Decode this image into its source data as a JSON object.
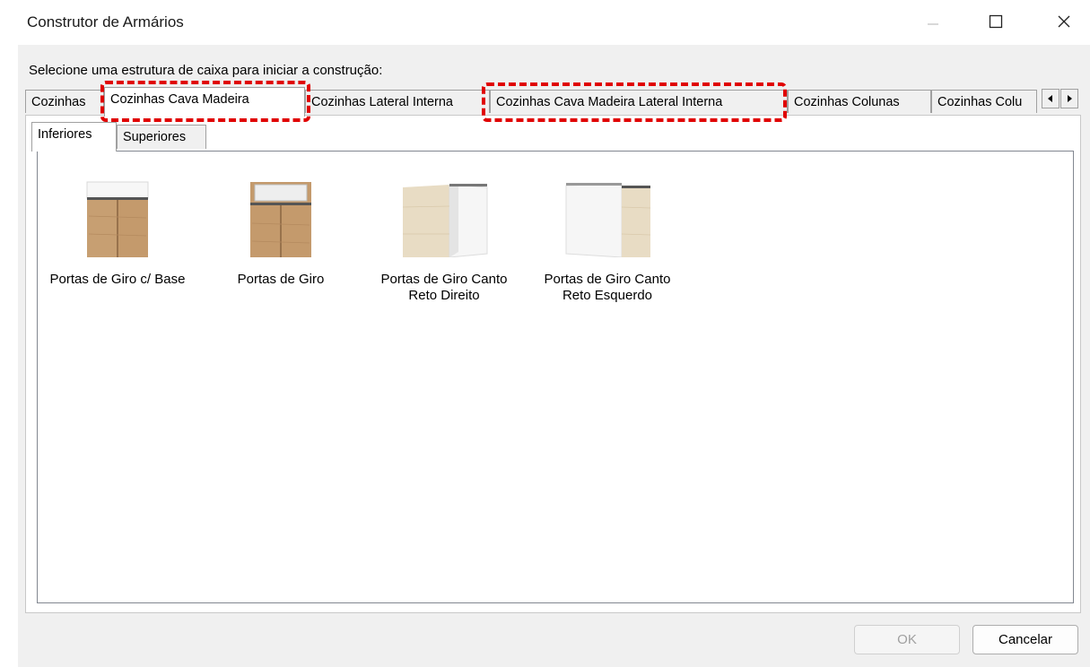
{
  "window": {
    "title": "Construtor de Armários"
  },
  "prompt": "Selecione uma estrutura de caixa para iniciar a construção:",
  "tabs": [
    {
      "label": "Cozinhas"
    },
    {
      "label": "Cozinhas Cava Madeira",
      "active": true
    },
    {
      "label": "Cozinhas Lateral Interna"
    },
    {
      "label": "Cozinhas Cava Madeira Lateral Interna"
    },
    {
      "label": "Cozinhas Colunas"
    },
    {
      "label": "Cozinhas Colu"
    }
  ],
  "subtabs": [
    {
      "label": "Inferiores",
      "active": true
    },
    {
      "label": "Superiores"
    }
  ],
  "items": [
    {
      "label": "Portas de Giro c/ Base",
      "icon": "cabinet-base-icon"
    },
    {
      "label": "Portas de Giro",
      "icon": "cabinet-icon"
    },
    {
      "label": "Portas de Giro Canto Reto Direito",
      "icon": "corner-cabinet-right-icon"
    },
    {
      "label": "Portas de Giro Canto Reto Esquerdo",
      "icon": "corner-cabinet-left-icon"
    }
  ],
  "buttons": {
    "ok": "OK",
    "cancel": "Cancelar"
  },
  "colors": {
    "highlight": "#e00000",
    "wood": "#c49a6c",
    "background": "#f0f0f0"
  }
}
